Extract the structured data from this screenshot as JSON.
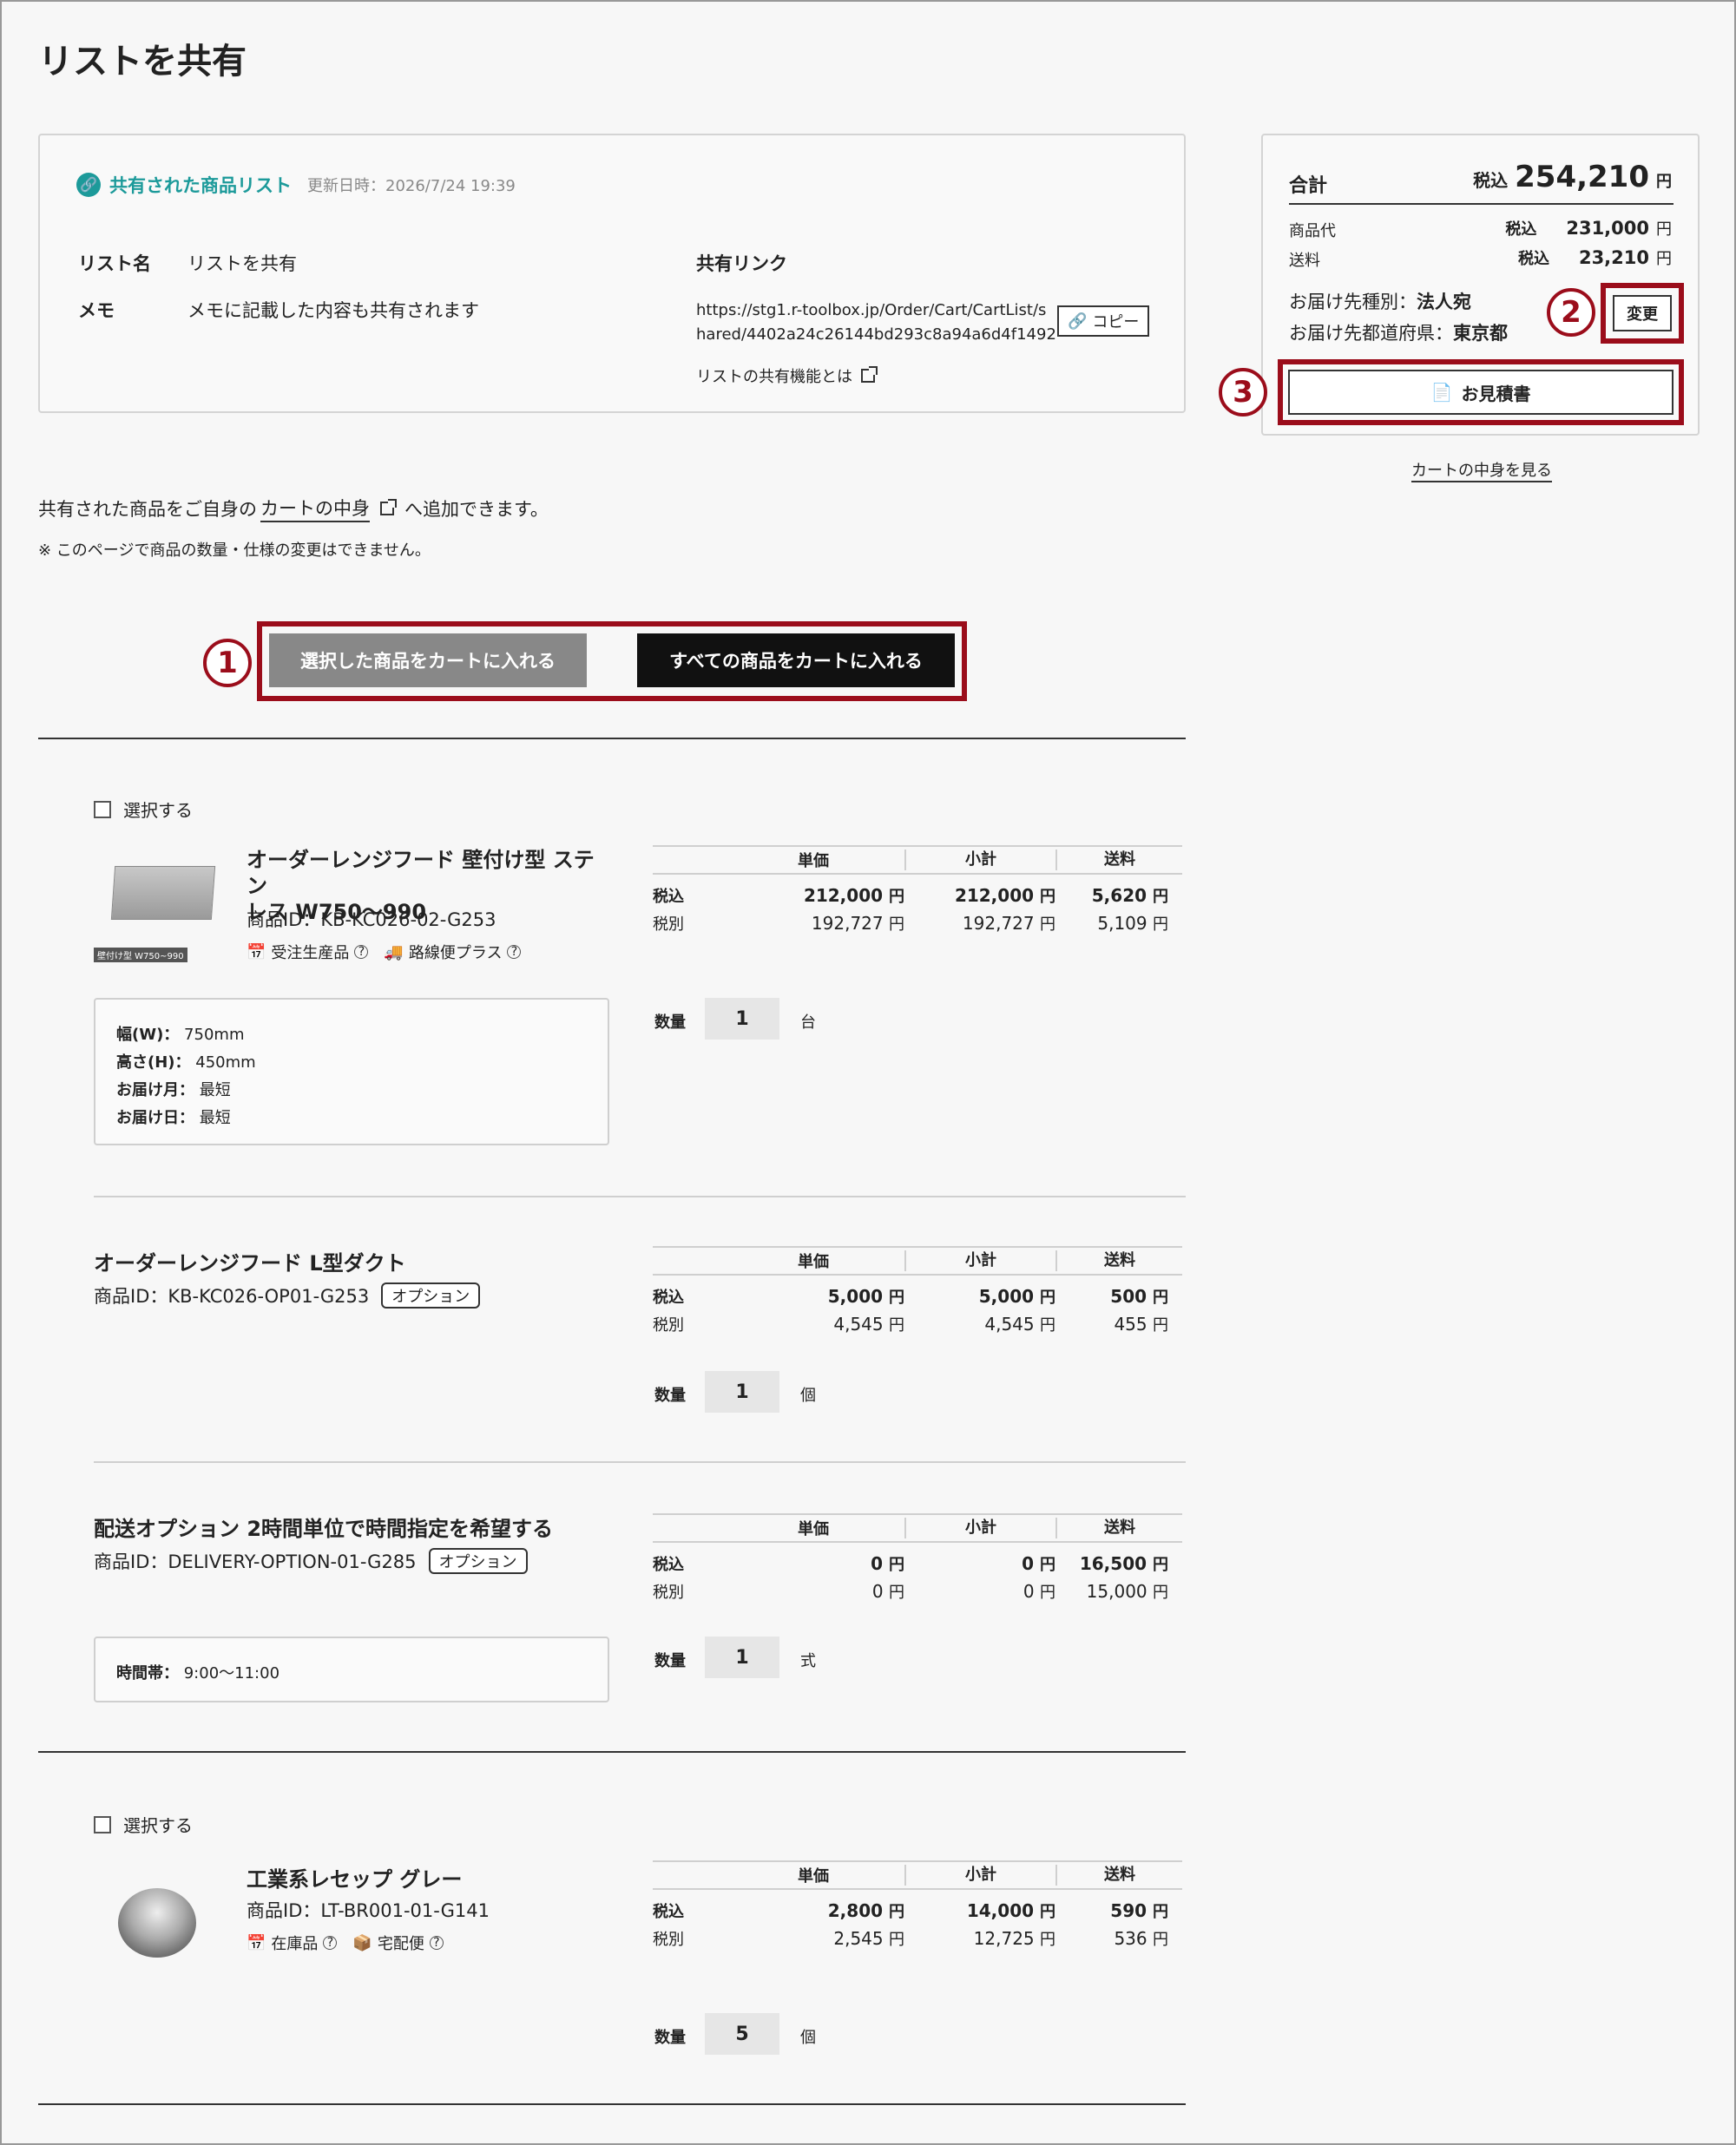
{
  "page": {
    "title": "リストを共有"
  },
  "share": {
    "heading": "共有された商品リスト",
    "updated": "更新日時：2026/7/24 19:39",
    "list_name_label": "リスト名",
    "list_name_value": "リストを共有",
    "memo_label": "メモ",
    "memo_value": "メモに記載した内容も共有されます",
    "link_label": "共有リンク",
    "link_line1": "https://stg1.r-toolbox.jp/Order/Cart/CartList/s",
    "link_line2": "hared/4402a24c26144bd293c8a94a6d4f1492",
    "copy_label": "コピー",
    "about_link": "リストの共有機能とは"
  },
  "summary": {
    "total_label": "合計",
    "tax_in": "税込",
    "total_value": "254,210",
    "yen": "円",
    "goods_label": "商品代",
    "goods_value": "231,000",
    "shipping_label": "送料",
    "shipping_value": "23,210",
    "dest_type_label": "お届け先種別：",
    "dest_type_value": "法人宛",
    "dest_pref_label": "お届け先都道府県：",
    "dest_pref_value": "東京都",
    "change_label": "変更",
    "estimate_label": "お見積書",
    "cart_link": "カートの中身を見る"
  },
  "notice": {
    "line1_pre": "共有された商品をご自身の",
    "line1_link": "カートの中身",
    "line1_post": "へ追加できます。",
    "line2": "※ このページで商品の数量・仕様の変更はできません。"
  },
  "actions": {
    "add_selected": "選択した商品をカートに入れる",
    "add_all": "すべての商品をカートに入れる"
  },
  "markers": {
    "m1": "1",
    "m2": "2",
    "m3": "3"
  },
  "table_headers": {
    "unit": "単価",
    "subtotal": "小計",
    "shipping": "送料",
    "tax_in": "税込",
    "tax_ex": "税別",
    "qty": "数量"
  },
  "select_label": "選択する",
  "items": [
    {
      "name_line1": "オーダーレンジフード 壁付け型 ステン",
      "name_line2": "レス W750〜990",
      "id": "商品ID：KB-KC026-02-G253",
      "tag1": "受注生産品",
      "tag2": "路線便プラス",
      "image_caption": "壁付け型 W750~990",
      "specs": [
        {
          "k": "幅(W)：",
          "v": "750mm"
        },
        {
          "k": "高さ(H)：",
          "v": "450mm"
        },
        {
          "k": "お届け月：",
          "v": "最短"
        },
        {
          "k": "お届け日：",
          "v": "最短"
        }
      ],
      "unit_in": "212,000",
      "sub_in": "212,000",
      "ship_in": "5,620",
      "unit_ex": "192,727",
      "sub_ex": "192,727",
      "ship_ex": "5,109",
      "qty": "1",
      "unit_word": "台"
    },
    {
      "name_line1": "オーダーレンジフード L型ダクト",
      "id": "商品ID：KB-KC026-OP01-G253",
      "badge": "オプション",
      "unit_in": "5,000",
      "sub_in": "5,000",
      "ship_in": "500",
      "unit_ex": "4,545",
      "sub_ex": "4,545",
      "ship_ex": "455",
      "qty": "1",
      "unit_word": "個"
    },
    {
      "name_line1": "配送オプション 2時間単位で時間指定を希望する",
      "id": "商品ID：DELIVERY-OPTION-01-G285",
      "badge": "オプション",
      "spec_k": "時間帯：",
      "spec_v": "9:00〜11:00",
      "unit_in": "0",
      "sub_in": "0",
      "ship_in": "16,500",
      "unit_ex": "0",
      "sub_ex": "0",
      "ship_ex": "15,000",
      "qty": "1",
      "unit_word": "式"
    },
    {
      "name_line1": "工業系レセップ グレー",
      "id": "商品ID：LT-BR001-01-G141",
      "tag1": "在庫品",
      "tag2": "宅配便",
      "unit_in": "2,800",
      "sub_in": "14,000",
      "ship_in": "590",
      "unit_ex": "2,545",
      "sub_ex": "12,725",
      "ship_ex": "536",
      "qty": "5",
      "unit_word": "個"
    }
  ]
}
